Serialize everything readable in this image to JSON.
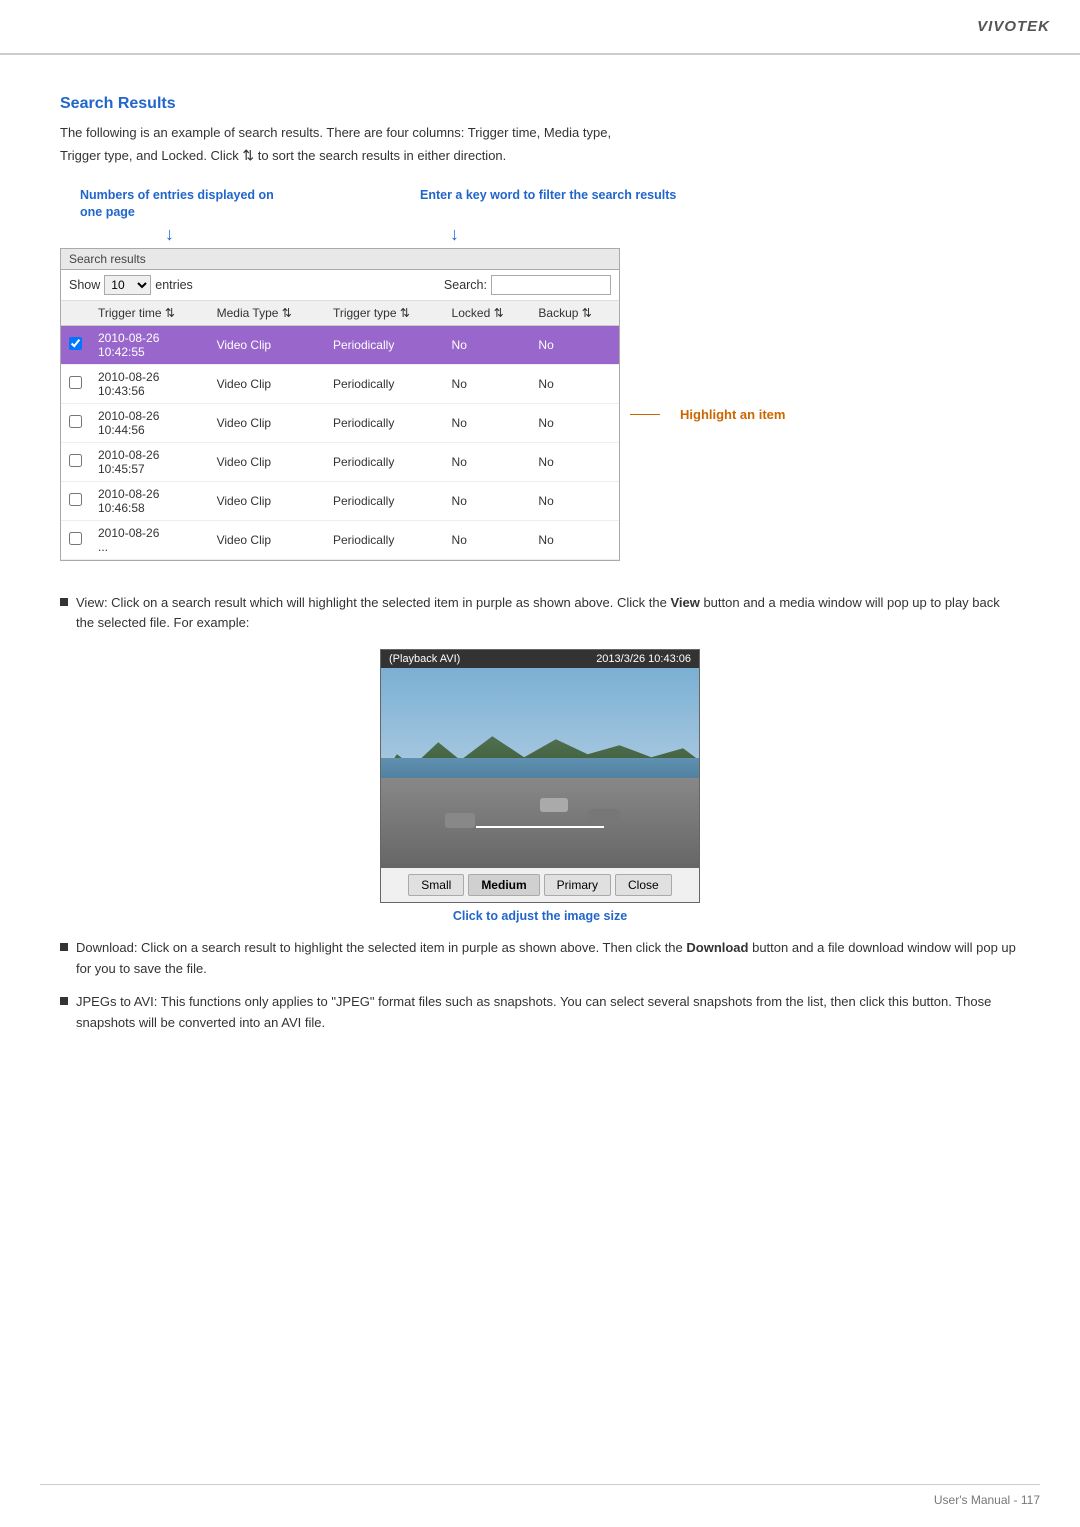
{
  "brand": "VIVOTEK",
  "header": {
    "title": "Search Results",
    "description_line1": "The following is an example of search results. There are four columns: Trigger time, Media type,",
    "description_line2": "Trigger type, and Locked. Click",
    "description_line3": "to sort the search results in either direction."
  },
  "annotations": {
    "left_title": "Numbers of entries displayed on one page",
    "right_title": "Enter a key word to filter the search results",
    "highlight_label": "Highlight an item"
  },
  "search_results": {
    "label": "Search results",
    "show_label": "Show",
    "show_value": "10",
    "entries_label": "entries",
    "search_label": "Search:",
    "columns": [
      "Trigger time",
      "Media Type",
      "Trigger type",
      "Locked",
      "Backup"
    ],
    "rows": [
      {
        "trigger_time": "2010-08-26\n10:42:55",
        "media_type": "Video Clip",
        "trigger_type": "Periodically",
        "locked": "No",
        "backup": "No",
        "highlighted": true
      },
      {
        "trigger_time": "2010-08-26\n10:43:56",
        "media_type": "Video Clip",
        "trigger_type": "Periodically",
        "locked": "No",
        "backup": "No",
        "highlighted": false
      },
      {
        "trigger_time": "2010-08-26\n10:44:56",
        "media_type": "Video Clip",
        "trigger_type": "Periodically",
        "locked": "No",
        "backup": "No",
        "highlighted": false
      },
      {
        "trigger_time": "2010-08-26\n10:45:57",
        "media_type": "Video Clip",
        "trigger_type": "Periodically",
        "locked": "No",
        "backup": "No",
        "highlighted": false
      },
      {
        "trigger_time": "2010-08-26\n10:46:58",
        "media_type": "Video Clip",
        "trigger_type": "Periodically",
        "locked": "No",
        "backup": "No",
        "highlighted": false
      },
      {
        "trigger_time": "2010-08-26\n...",
        "media_type": "Video Clip",
        "trigger_type": "Periodically",
        "locked": "No",
        "backup": "No",
        "highlighted": false
      }
    ]
  },
  "media_player": {
    "title_left": "(Playback AVI)",
    "title_right": "2013/3/26 10:43:06",
    "buttons": [
      "Small",
      "Medium",
      "Primary",
      "Close"
    ],
    "click_label": "Click to adjust the image size"
  },
  "bullet_items": [
    {
      "id": "view",
      "text_parts": {
        "prefix": "View: Click on a search result which will highlight the selected item in purple as shown above. Click the ",
        "bold": "View",
        "suffix": " button and a media window will pop up to play back the selected file. For example:"
      }
    },
    {
      "id": "download",
      "text_parts": {
        "prefix": "Download: Click on a search result to highlight the selected item in purple as shown above. Then click the ",
        "bold": "Download",
        "suffix": " button and a file download window will pop up for you to save the file."
      }
    },
    {
      "id": "jpegs",
      "text_parts": {
        "prefix": "JPEGs to AVI: This functions only applies to “JPEG” format files such as snapshots. You can select several snapshots from the list, then click this button. Those snapshots will be converted into an AVI file."
      }
    }
  ],
  "footer": {
    "text": "User's Manual - 117"
  }
}
